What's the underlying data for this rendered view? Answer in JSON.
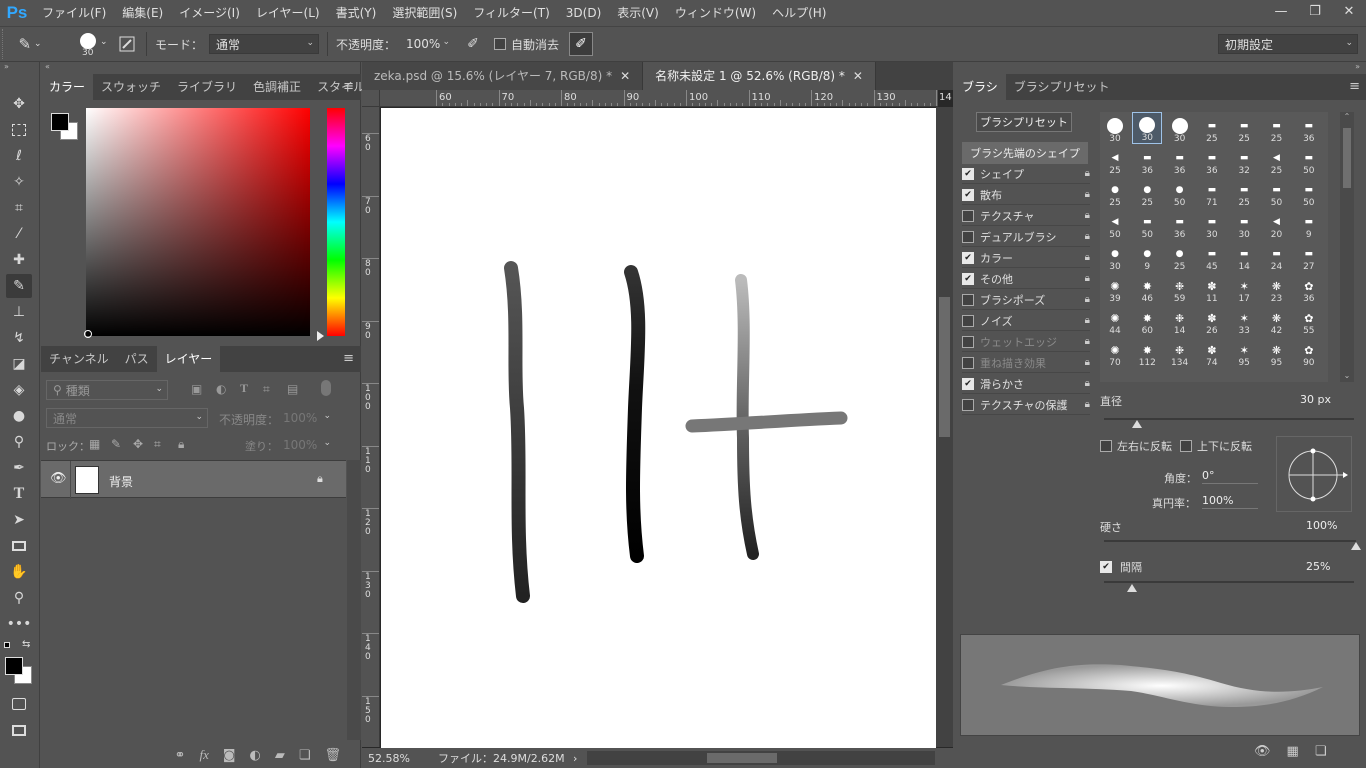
{
  "app": {
    "logo": "Ps"
  },
  "menu": [
    "ファイル(F)",
    "編集(E)",
    "イメージ(I)",
    "レイヤー(L)",
    "書式(Y)",
    "選択範囲(S)",
    "フィルター(T)",
    "3D(D)",
    "表示(V)",
    "ウィンドウ(W)",
    "ヘルプ(H)"
  ],
  "window_controls": {
    "minimize": "—",
    "restore": "❐",
    "close": "✕"
  },
  "options": {
    "brush_size": "30",
    "mode_label": "モード：",
    "mode_value": "通常",
    "opacity_label": "不透明度：",
    "opacity_value": "100%",
    "auto_erase_label": "自動消去",
    "workspace": "初期設定"
  },
  "left_panel": {
    "color_tabs": [
      "カラー",
      "スウォッチ",
      "ライブラリ",
      "色調補正",
      "スタイル"
    ],
    "layer_tabs": [
      "チャンネル",
      "パス",
      "レイヤー"
    ],
    "filter_placeholder": "種類",
    "blend_mode": "通常",
    "opacity_label": "不透明度：",
    "opacity_value": "100%",
    "lock_label": "ロック：",
    "fill_label": "塗り：",
    "fill_value": "100%",
    "layers": [
      {
        "name": "背景",
        "visible": true,
        "locked": true
      }
    ],
    "bottom_icons": [
      "link-icon",
      "fx-icon",
      "mask-icon",
      "adjustment-icon",
      "group-icon",
      "new-layer-icon",
      "trash-icon"
    ]
  },
  "document": {
    "tabs": [
      {
        "label": "zeka.psd @ 15.6% (レイヤー 7, RGB/8) *",
        "close": "✕"
      },
      {
        "label": "名称未設定 1 @ 52.6% (RGB/8) *",
        "close": "✕"
      }
    ],
    "ruler_h": [
      "60",
      "70",
      "80",
      "90",
      "100",
      "110",
      "120",
      "130",
      "14"
    ],
    "ruler_v": [
      "6\n0",
      "7\n0",
      "8\n0",
      "9\n0",
      "1\n0\n0",
      "1\n1\n0",
      "1\n2\n0",
      "1\n3\n0",
      "1\n4\n0",
      "1\n5\n0"
    ],
    "zoom": "52.58%",
    "file_info": "ファイル：24.9M/2.62M"
  },
  "right_panel": {
    "tabs": [
      "ブラシ",
      "ブラシプリセット"
    ],
    "preset_button": "ブラシプリセット",
    "tip_shape_header": "ブラシ先端のシェイプ",
    "options": [
      {
        "label": "シェイプ",
        "checked": true,
        "dim": false
      },
      {
        "label": "散布",
        "checked": true,
        "dim": false
      },
      {
        "label": "テクスチャ",
        "checked": false,
        "dim": false
      },
      {
        "label": "デュアルブラシ",
        "checked": false,
        "dim": false
      },
      {
        "label": "カラー",
        "checked": true,
        "dim": false
      },
      {
        "label": "その他",
        "checked": true,
        "dim": false
      },
      {
        "label": "ブラシポーズ",
        "checked": false,
        "dim": false
      },
      {
        "label": "ノイズ",
        "checked": false,
        "dim": false
      },
      {
        "label": "ウェットエッジ",
        "checked": false,
        "dim": true
      },
      {
        "label": "重ね描き効果",
        "checked": false,
        "dim": true
      },
      {
        "label": "滑らかさ",
        "checked": true,
        "dim": false
      },
      {
        "label": "テクスチャの保護",
        "checked": false,
        "dim": false
      }
    ],
    "tip_sizes": [
      "30",
      "30",
      "30",
      "25",
      "25",
      "25",
      "36",
      "25",
      "36",
      "36",
      "36",
      "32",
      "25",
      "50",
      "25",
      "25",
      "50",
      "71",
      "25",
      "50",
      "50",
      "50",
      "50",
      "36",
      "30",
      "30",
      "20",
      "9",
      "30",
      "9",
      "25",
      "45",
      "14",
      "24",
      "27",
      "39",
      "46",
      "59",
      "11",
      "17",
      "23",
      "36",
      "44",
      "60",
      "14",
      "26",
      "33",
      "42",
      "55",
      "70",
      "112",
      "134",
      "74",
      "95",
      "95",
      "90"
    ],
    "diameter_label": "直径",
    "diameter_value": "30 px",
    "flip_x": "左右に反転",
    "flip_y": "上下に反転",
    "angle_label": "角度：",
    "angle_value": "0°",
    "roundness_label": "真円率：",
    "roundness_value": "100%",
    "hardness_label": "硬さ",
    "hardness_value": "100%",
    "spacing_label": "間隔",
    "spacing_value": "25%"
  }
}
